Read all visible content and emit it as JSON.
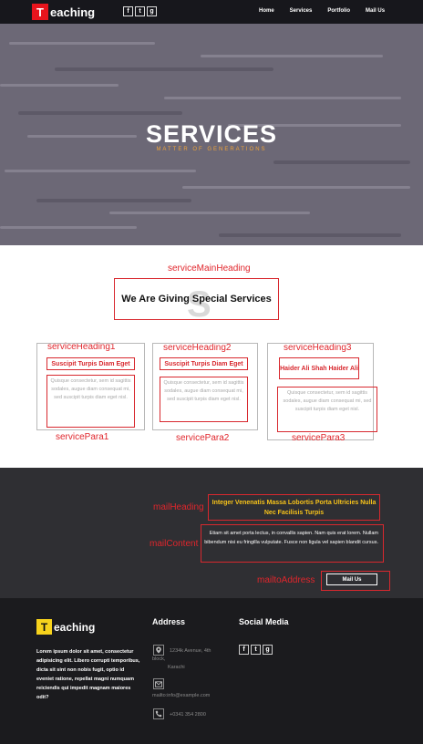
{
  "nav": {
    "logo_badge": "T",
    "logo_text": "eaching",
    "social": [
      "f",
      "t",
      "g"
    ],
    "menu": [
      "Home",
      "Services",
      "Portfolio",
      "Mail Us"
    ]
  },
  "hero": {
    "title": "SERVICES",
    "subtitle": "MATTER OF GENERATIONS"
  },
  "services": {
    "main_heading_label": "serviceMainHeading",
    "watermark": "S",
    "main_heading": "We Are Giving Special Services",
    "cards": [
      {
        "heading_label": "serviceHeading1",
        "heading": "Suscipit Turpis Diam Eget",
        "para": "Quisque consectetur, sem id sagittis sodales, augue diam consequat mi, sed suscipit turpis diam eget nisl.",
        "para_label": "servicePara1"
      },
      {
        "heading_label": "serviceHeading2",
        "heading": "Suscipit Turpis Diam Eget",
        "para": "Quisque consectetur, sem id sagittis sodales, augue diam consequat mi, sed suscipit turpis diam eget nisl.",
        "para_label": "servicePara2"
      },
      {
        "heading_label": "serviceHeading3",
        "heading": "Haider Ali Shah Haider Ali",
        "para": "Quisque consectetur, sem id sagittis sodales, augue diam consequat mi, sed suscipit turpis diam eget nisl.",
        "para_label": "servicePara3"
      }
    ]
  },
  "mail": {
    "heading_label": "mailHeading",
    "heading": "Integer Venenatis Massa Lobortis Porta Ultricies Nulla Nec Facilisis Turpis",
    "content_label": "mailContent",
    "content": "Etiam sit amet porta lectus, in convallis sapien. Nam quis erat lorem. Nullam bibendum nisi eu fringilla vulputate. Fusce non ligula vel sapien blandit cursus.",
    "address_label": "mailtoAddress",
    "button": "Mail Us"
  },
  "footer": {
    "logo_badge": "T",
    "logo_text": "eaching",
    "about": "Lorem ipsum dolor sit amet, consectetur adipisicing elit. Libero corrupti temporibus, dicta sit sint non nobis fugit, optio id eveniet ratione, repellat magni numquam reiciendis qui impedit magnam maiores odit?",
    "address_title": "Address",
    "address_line1": "1234k Avenue, 4th",
    "address_line2": "block,",
    "address_line3": "Karachi",
    "email": "mailto:info@example.com",
    "phone": "+0341 354 2800",
    "social_title": "Social Media",
    "social": [
      "f",
      "t",
      "g"
    ],
    "icons": {
      "address": "map-marker-icon",
      "email": "envelope-icon",
      "phone": "phone-icon"
    }
  }
}
